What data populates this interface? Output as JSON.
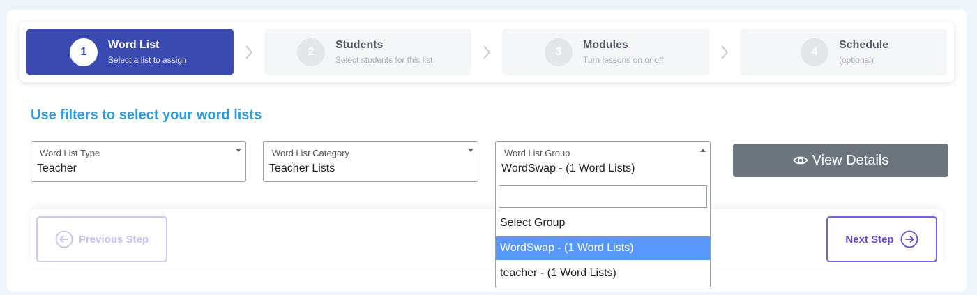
{
  "steps": [
    {
      "num": "1",
      "title": "Word List",
      "sub": "Select a list to assign",
      "active": true
    },
    {
      "num": "2",
      "title": "Students",
      "sub": "Select students for this list",
      "active": false
    },
    {
      "num": "3",
      "title": "Modules",
      "sub": "Turn lessons on or off",
      "active": false
    },
    {
      "num": "4",
      "title": "Schedule",
      "sub": "(optional)",
      "active": false
    }
  ],
  "heading": "Use filters to select your word lists",
  "filters": {
    "type": {
      "label": "Word List Type",
      "value": "Teacher"
    },
    "category": {
      "label": "Word List Category",
      "value": "Teacher Lists"
    },
    "group": {
      "label": "Word List Group",
      "value": "WordSwap - (1 Word Lists)"
    }
  },
  "dropdown": {
    "search_value": "",
    "options": [
      "Select Group",
      "WordSwap - (1 Word Lists)",
      "teacher - (1 Word Lists)"
    ],
    "selected_index": 1
  },
  "view_details_label": "View Details",
  "nav": {
    "prev_label": "Previous Step",
    "next_label": "Next Step"
  },
  "colors": {
    "primary": "#3a4ab0",
    "heading": "#2f9be0",
    "option_selected": "#5897fb",
    "next": "#6a47cf"
  }
}
